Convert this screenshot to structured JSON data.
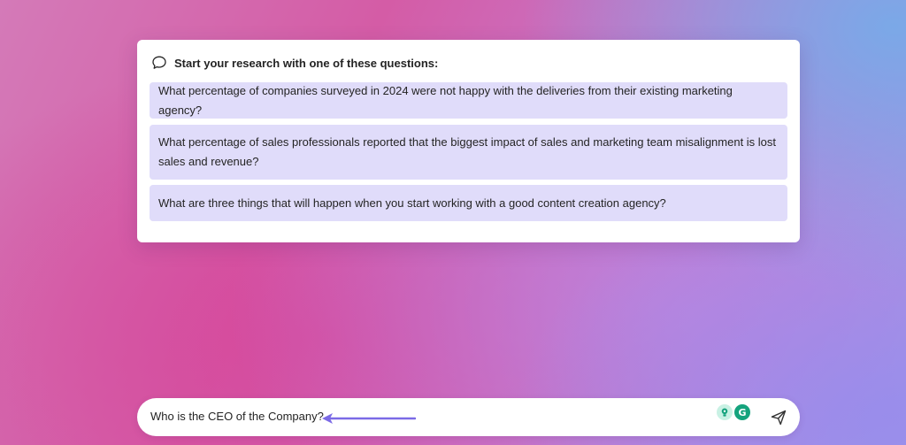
{
  "research_card": {
    "title": "Start your research with one of these questions:",
    "icon": "chat-bubble-icon",
    "questions": [
      {
        "text": "What percentage of companies surveyed in 2024 were not happy with the deliveries from their existing marketing agency?"
      },
      {
        "text": "What percentage of sales professionals reported that the biggest impact of sales and marketing team misalignment is lost sales and revenue?"
      },
      {
        "text": "What are three things that will happen when you start working with a good content creation agency?"
      }
    ]
  },
  "chat_input": {
    "value": "Who is the CEO of the Company?",
    "extension_icons": [
      "lightbulb-icon",
      "grammarly-icon"
    ],
    "grammarly_letter": "G",
    "send_icon": "send-icon"
  },
  "annotation": {
    "arrow_color": "#7b6ae6"
  },
  "colors": {
    "question_bg": "#e0dcfa",
    "card_bg": "#ffffff",
    "grammarly": "#15a37d"
  }
}
